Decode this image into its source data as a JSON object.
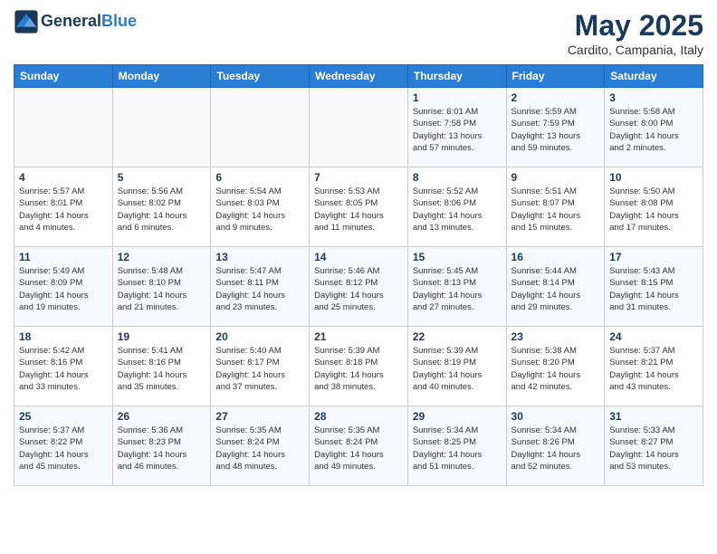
{
  "header": {
    "logo_line1": "General",
    "logo_line2": "Blue",
    "month": "May 2025",
    "location": "Cardito, Campania, Italy"
  },
  "weekdays": [
    "Sunday",
    "Monday",
    "Tuesday",
    "Wednesday",
    "Thursday",
    "Friday",
    "Saturday"
  ],
  "weeks": [
    [
      {
        "day": "",
        "info": ""
      },
      {
        "day": "",
        "info": ""
      },
      {
        "day": "",
        "info": ""
      },
      {
        "day": "",
        "info": ""
      },
      {
        "day": "1",
        "info": "Sunrise: 6:01 AM\nSunset: 7:58 PM\nDaylight: 13 hours\nand 57 minutes."
      },
      {
        "day": "2",
        "info": "Sunrise: 5:59 AM\nSunset: 7:59 PM\nDaylight: 13 hours\nand 59 minutes."
      },
      {
        "day": "3",
        "info": "Sunrise: 5:58 AM\nSunset: 8:00 PM\nDaylight: 14 hours\nand 2 minutes."
      }
    ],
    [
      {
        "day": "4",
        "info": "Sunrise: 5:57 AM\nSunset: 8:01 PM\nDaylight: 14 hours\nand 4 minutes."
      },
      {
        "day": "5",
        "info": "Sunrise: 5:56 AM\nSunset: 8:02 PM\nDaylight: 14 hours\nand 6 minutes."
      },
      {
        "day": "6",
        "info": "Sunrise: 5:54 AM\nSunset: 8:03 PM\nDaylight: 14 hours\nand 9 minutes."
      },
      {
        "day": "7",
        "info": "Sunrise: 5:53 AM\nSunset: 8:05 PM\nDaylight: 14 hours\nand 11 minutes."
      },
      {
        "day": "8",
        "info": "Sunrise: 5:52 AM\nSunset: 8:06 PM\nDaylight: 14 hours\nand 13 minutes."
      },
      {
        "day": "9",
        "info": "Sunrise: 5:51 AM\nSunset: 8:07 PM\nDaylight: 14 hours\nand 15 minutes."
      },
      {
        "day": "10",
        "info": "Sunrise: 5:50 AM\nSunset: 8:08 PM\nDaylight: 14 hours\nand 17 minutes."
      }
    ],
    [
      {
        "day": "11",
        "info": "Sunrise: 5:49 AM\nSunset: 8:09 PM\nDaylight: 14 hours\nand 19 minutes."
      },
      {
        "day": "12",
        "info": "Sunrise: 5:48 AM\nSunset: 8:10 PM\nDaylight: 14 hours\nand 21 minutes."
      },
      {
        "day": "13",
        "info": "Sunrise: 5:47 AM\nSunset: 8:11 PM\nDaylight: 14 hours\nand 23 minutes."
      },
      {
        "day": "14",
        "info": "Sunrise: 5:46 AM\nSunset: 8:12 PM\nDaylight: 14 hours\nand 25 minutes."
      },
      {
        "day": "15",
        "info": "Sunrise: 5:45 AM\nSunset: 8:13 PM\nDaylight: 14 hours\nand 27 minutes."
      },
      {
        "day": "16",
        "info": "Sunrise: 5:44 AM\nSunset: 8:14 PM\nDaylight: 14 hours\nand 29 minutes."
      },
      {
        "day": "17",
        "info": "Sunrise: 5:43 AM\nSunset: 8:15 PM\nDaylight: 14 hours\nand 31 minutes."
      }
    ],
    [
      {
        "day": "18",
        "info": "Sunrise: 5:42 AM\nSunset: 8:16 PM\nDaylight: 14 hours\nand 33 minutes."
      },
      {
        "day": "19",
        "info": "Sunrise: 5:41 AM\nSunset: 8:16 PM\nDaylight: 14 hours\nand 35 minutes."
      },
      {
        "day": "20",
        "info": "Sunrise: 5:40 AM\nSunset: 8:17 PM\nDaylight: 14 hours\nand 37 minutes."
      },
      {
        "day": "21",
        "info": "Sunrise: 5:39 AM\nSunset: 8:18 PM\nDaylight: 14 hours\nand 38 minutes."
      },
      {
        "day": "22",
        "info": "Sunrise: 5:39 AM\nSunset: 8:19 PM\nDaylight: 14 hours\nand 40 minutes."
      },
      {
        "day": "23",
        "info": "Sunrise: 5:38 AM\nSunset: 8:20 PM\nDaylight: 14 hours\nand 42 minutes."
      },
      {
        "day": "24",
        "info": "Sunrise: 5:37 AM\nSunset: 8:21 PM\nDaylight: 14 hours\nand 43 minutes."
      }
    ],
    [
      {
        "day": "25",
        "info": "Sunrise: 5:37 AM\nSunset: 8:22 PM\nDaylight: 14 hours\nand 45 minutes."
      },
      {
        "day": "26",
        "info": "Sunrise: 5:36 AM\nSunset: 8:23 PM\nDaylight: 14 hours\nand 46 minutes."
      },
      {
        "day": "27",
        "info": "Sunrise: 5:35 AM\nSunset: 8:24 PM\nDaylight: 14 hours\nand 48 minutes."
      },
      {
        "day": "28",
        "info": "Sunrise: 5:35 AM\nSunset: 8:24 PM\nDaylight: 14 hours\nand 49 minutes."
      },
      {
        "day": "29",
        "info": "Sunrise: 5:34 AM\nSunset: 8:25 PM\nDaylight: 14 hours\nand 51 minutes."
      },
      {
        "day": "30",
        "info": "Sunrise: 5:34 AM\nSunset: 8:26 PM\nDaylight: 14 hours\nand 52 minutes."
      },
      {
        "day": "31",
        "info": "Sunrise: 5:33 AM\nSunset: 8:27 PM\nDaylight: 14 hours\nand 53 minutes."
      }
    ]
  ]
}
